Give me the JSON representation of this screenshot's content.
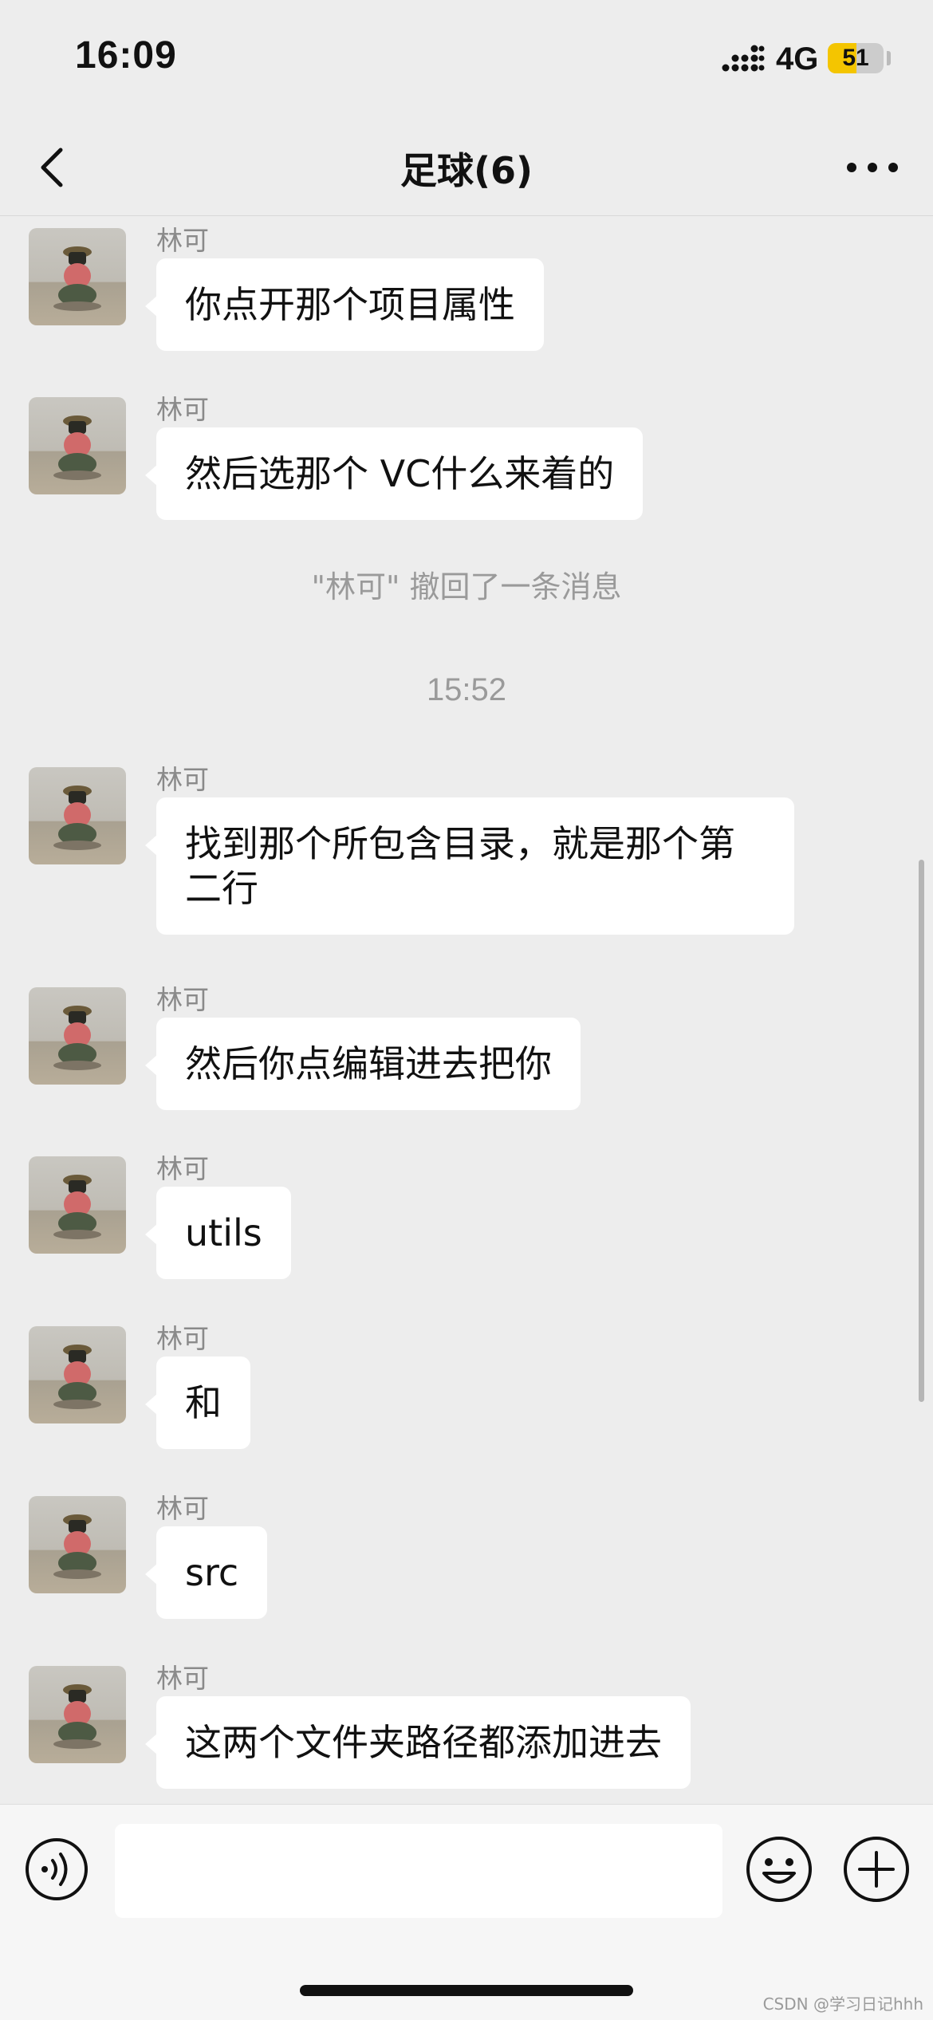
{
  "status_bar": {
    "time": "16:09",
    "network": "4G",
    "battery_percent": "51",
    "battery_level": 0.51
  },
  "nav": {
    "title": "足球(6)"
  },
  "messages": [
    {
      "sender": "林可",
      "text": "你点开那个项目属性"
    },
    {
      "sender": "林可",
      "text": "然后选那个 VC什么来着的"
    },
    {
      "sender": "林可",
      "text": "找到那个所包含目录，就是那个第二行"
    },
    {
      "sender": "林可",
      "text": "然后你点编辑进去把你"
    },
    {
      "sender": "林可",
      "text": "utils"
    },
    {
      "sender": "林可",
      "text": "和"
    },
    {
      "sender": "林可",
      "text": "src"
    },
    {
      "sender": "林可",
      "text": "这两个文件夹路径都添加进去"
    }
  ],
  "system_note": "\"林可\" 撤回了一条消息",
  "timestamp": "15:52",
  "input": {
    "value": "",
    "placeholder": ""
  },
  "watermark": "CSDN @学习日记hhh",
  "icons": {
    "back": "chevron-left-icon",
    "more": "more-icon",
    "voice": "voice-icon",
    "emoji": "emoji-icon",
    "plus": "plus-icon"
  },
  "colors": {
    "background": "#ededed",
    "bubble": "#ffffff",
    "battery": "#f4c500"
  }
}
